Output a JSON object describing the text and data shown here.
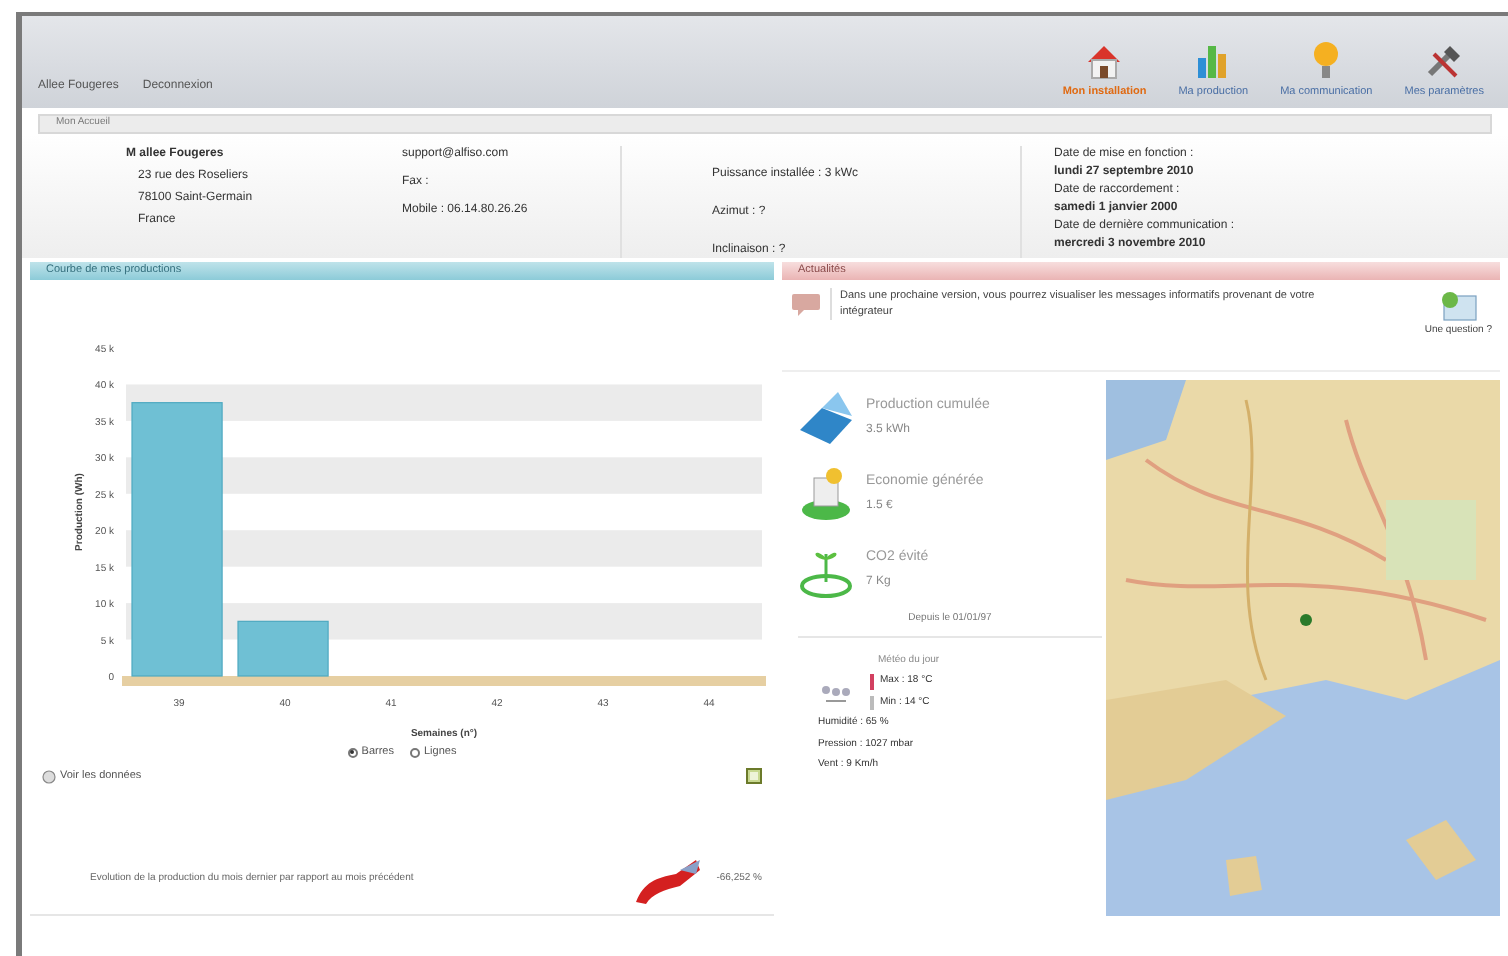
{
  "top_links": [
    "Allee Fougeres",
    "Deconnexion"
  ],
  "tabs": [
    {
      "label": "Mon installation",
      "selected": true,
      "kind": "house"
    },
    {
      "label": "Ma production",
      "selected": false,
      "kind": "bars"
    },
    {
      "label": "Ma communication",
      "selected": false,
      "kind": "bulb"
    },
    {
      "label": "Mes paramètres",
      "selected": false,
      "kind": "tools"
    }
  ],
  "breadcrumb": "Mon Accueil",
  "owner": {
    "name": "M allee Fougeres",
    "address": [
      "23 rue des Roseliers",
      "78100 Saint-Germain",
      "France"
    ],
    "contact": [
      "support@alfiso.com",
      "Fax :",
      "Mobile : 06.14.80.26.26"
    ],
    "specs": [
      "Puissance installée : 3 kWc",
      "Azimut : ?",
      "Inclinaison : ?"
    ],
    "dates": [
      {
        "label": "Date de mise en fonction :",
        "value": "lundi 27 septembre 2010"
      },
      {
        "label": "Date de raccordement :",
        "value": "samedi 1 janvier 2000"
      },
      {
        "label": "Date de dernière communication :",
        "value": "mercredi 3 novembre 2010"
      }
    ]
  },
  "production_panel": {
    "title": "Courbe de mes productions",
    "chart_data": {
      "type": "bar",
      "xlabel": "Semaines (n°)",
      "ylabel": "Production (Wh)",
      "categories": [
        "39",
        "40",
        "41",
        "42",
        "43",
        "44"
      ],
      "series": [
        {
          "color": "#6fc0d4",
          "values": [
            37500,
            7500,
            0,
            0,
            0,
            0
          ]
        }
      ],
      "ylim": [
        0,
        45000
      ],
      "yticks": [
        {
          "value": 0,
          "label": "0"
        },
        {
          "value": 5000,
          "label": "5 k"
        },
        {
          "value": 10000,
          "label": "10 k"
        },
        {
          "value": 15000,
          "label": "15 k"
        },
        {
          "value": 20000,
          "label": "20 k"
        },
        {
          "value": 25000,
          "label": "25 k"
        },
        {
          "value": 30000,
          "label": "30 k"
        },
        {
          "value": 35000,
          "label": "35 k"
        },
        {
          "value": 40000,
          "label": "40 k"
        },
        {
          "value": 45000,
          "label": "45 k"
        }
      ]
    },
    "modes": [
      {
        "label": "Barres",
        "selected": true
      },
      {
        "label": "Lignes",
        "selected": false
      }
    ],
    "data_link": "Voir les données",
    "evolution_text": "Evolution de la production du mois dernier par rapport au mois précédent",
    "evolution_value": "-66,252 %"
  },
  "news_panel": {
    "title": "Actualités",
    "message": "Dans une prochaine version, vous pourrez visualiser les messages informatifs provenant de votre intégrateur",
    "question_link": "Une question ?",
    "stats": [
      {
        "kind": "panel",
        "label": "Production cumulée",
        "value": "3.5 kWh"
      },
      {
        "kind": "money",
        "label": "Economie générée",
        "value": "1.5 €"
      },
      {
        "kind": "plant",
        "label": "CO2 évité",
        "value": "7 Kg"
      }
    ],
    "since": "Depuis le 01/01/97",
    "weather": {
      "title": "Météo du jour",
      "max": "Max : 18 °C",
      "min": "Min : 14 °C",
      "details": [
        "Humidité : 65 %",
        "Pression : 1027 mbar",
        "Vent : 9 Km/h"
      ]
    }
  }
}
